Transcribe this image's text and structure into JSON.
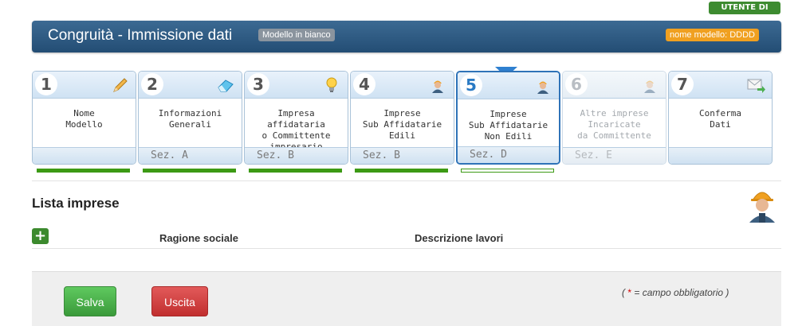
{
  "user_badge": "UTENTE DI TEST",
  "header": {
    "title": "Congruità - Immissione dati",
    "tag_blank": "Modello in bianco",
    "model_name": "nome modello: DDDD"
  },
  "steps": [
    {
      "num": "1",
      "lines": [
        "Nome",
        "Modello",
        ""
      ],
      "section": "",
      "icon": "pencil-icon",
      "state": "done"
    },
    {
      "num": "2",
      "lines": [
        "Informazioni",
        "Generali",
        ""
      ],
      "section": "Sez. A",
      "icon": "eraser-icon",
      "state": "done"
    },
    {
      "num": "3",
      "lines": [
        "Impresa affidataria",
        "o Committente",
        "impresario"
      ],
      "section": "Sez. B",
      "icon": "lightbulb-icon",
      "state": "done"
    },
    {
      "num": "4",
      "lines": [
        "Imprese",
        "Sub Affidatarie",
        "Edili"
      ],
      "section": "Sez. B",
      "icon": "worker-icon",
      "state": "done"
    },
    {
      "num": "5",
      "lines": [
        "Imprese",
        "Sub Affidatarie",
        "Non Edili"
      ],
      "section": "Sez. D",
      "icon": "worker-icon",
      "state": "active"
    },
    {
      "num": "6",
      "lines": [
        "Altre imprese",
        "Incaricate",
        "da Committente"
      ],
      "section": "Sez. E",
      "icon": "worker-icon",
      "state": "disabled"
    },
    {
      "num": "7",
      "lines": [
        "Conferma",
        "Dati",
        ""
      ],
      "section": "",
      "icon": "envelope-icon",
      "state": "pending"
    }
  ],
  "progress": [
    {
      "state": "complete"
    },
    {
      "state": "complete"
    },
    {
      "state": "complete"
    },
    {
      "state": "complete"
    },
    {
      "state": "empty"
    }
  ],
  "section_title": "Lista imprese",
  "table": {
    "add_label": "+",
    "columns": [
      "Ragione sociale",
      "Descrizione lavori"
    ]
  },
  "footer": {
    "save": "Salva",
    "exit": "Uscita",
    "required_prefix": "( ",
    "required_star": "*",
    "required_suffix": " = campo obbligatorio )"
  },
  "colors": {
    "header_bg": "#2d5a82",
    "active_border": "#2f73b8",
    "progress": "#3c9a14",
    "save": "#4caf50",
    "exit": "#d63b3b"
  }
}
